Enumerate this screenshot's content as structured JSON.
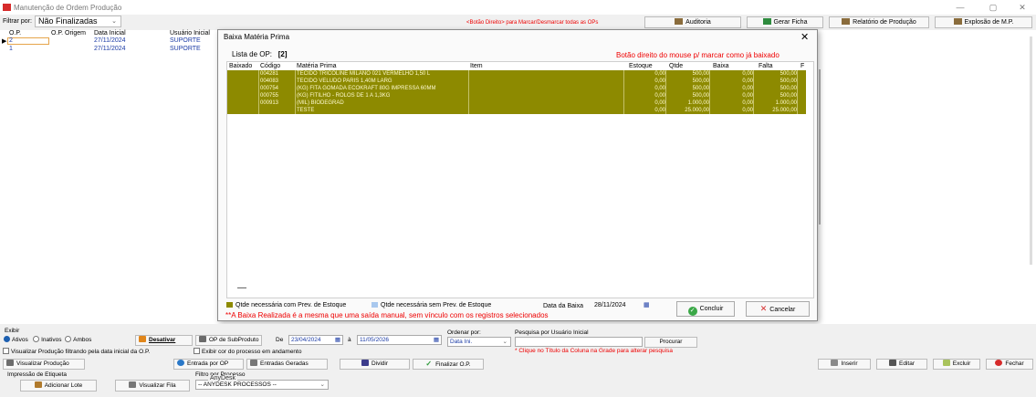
{
  "window": {
    "title": "Manutenção de Ordem Produção",
    "minimize": "—",
    "maximize": "▢",
    "close": "✕"
  },
  "toolbar": {
    "filtrar_label": "Filtrar por:",
    "filtrar_value": "Não Finalizadas",
    "hint": "<Botão Direito> para Marcar/Desmarcar todas as OPs",
    "auditoria": "Auditoria",
    "gerar_ficha": "Gerar Ficha",
    "relatorio": "Relatório de Produção",
    "explosao": "Explosão de M.P."
  },
  "main_grid": {
    "headers": [
      "O.P.",
      "O.P. Origem",
      "Data Inicial",
      "Usuário Inicial"
    ],
    "rows": [
      {
        "op": "2",
        "origem": "",
        "data": "27/11/2024",
        "usuario": "SUPORTE"
      },
      {
        "op": "1",
        "origem": "",
        "data": "27/11/2024",
        "usuario": "SUPORTE"
      }
    ]
  },
  "dialog": {
    "title": "Baixa Matéria Prima",
    "close": "✕",
    "lista_label": "Lista de OP:",
    "lista_value": "[2]",
    "hint": "Botão direito do mouse p/ marcar como já baixado",
    "headers": [
      "Baixado",
      "Código",
      "Matéria Prima",
      "Item",
      "Estoque",
      "Qtde",
      "Baixa",
      "Falta",
      "F"
    ],
    "rows": [
      {
        "codigo": "004281",
        "materia": "TECIDO TRICOLINE MILANO 021 VERMELHO 1,50 L",
        "item": "",
        "estoque": "0,00",
        "qtde": "500,00",
        "baixa": "0,00",
        "falta": "500,00"
      },
      {
        "codigo": "004083",
        "materia": "TECIDO VELUDO PARIS 1,40M LARG",
        "item": "",
        "estoque": "0,00",
        "qtde": "500,00",
        "baixa": "0,00",
        "falta": "500,00"
      },
      {
        "codigo": "000754",
        "materia": "(KG) FITA GOMADA ECOKRAFT 80G IMPRESSA 60MM",
        "item": "",
        "estoque": "0,00",
        "qtde": "500,00",
        "baixa": "0,00",
        "falta": "500,00"
      },
      {
        "codigo": "000755",
        "materia": "(KG) FITILHO - ROLOS DE 1 A 1,3KG",
        "item": "",
        "estoque": "0,00",
        "qtde": "500,00",
        "baixa": "0,00",
        "falta": "500,00"
      },
      {
        "codigo": "000913",
        "materia": "(MIL) BIODEGRAD",
        "item": "",
        "estoque": "0,00",
        "qtde": "1.000,00",
        "baixa": "0,00",
        "falta": "1.000,00"
      },
      {
        "codigo": "",
        "materia": "TESTE",
        "item": "",
        "estoque": "0,00",
        "qtde": "25.000,00",
        "baixa": "0,00",
        "falta": "25.000,00"
      }
    ],
    "legend_with": "Qtde necessária com Prev. de Estoque",
    "legend_without": "Qtde necessária sem Prev. de Estoque",
    "data_baixa_label": "Data da Baixa",
    "data_baixa_value": "28/11/2024",
    "concluir": "Concluir",
    "cancelar": "Cancelar",
    "warning": "**A Baixa Realizada é a mesma que uma saída manual, sem vínculo com os registros selecionados",
    "row_color": "#8d8a00",
    "legend_color_with": "#8d8a00",
    "legend_color_without": "#a9c8ee"
  },
  "bottom": {
    "exibir_label": "Exibir",
    "ativos": "Ativos",
    "inativos": "Inativos",
    "ambos": "Ambos",
    "desativar": "Desativar",
    "op_subproduto": "OP de SubProduto",
    "de_label": "De",
    "de_value": "23/04/2024",
    "a_label": "à",
    "a_value": "11/05/2026",
    "ordenar_label": "Ordenar por:",
    "ordenar_value": "Data Ini.",
    "pesquisa_label": "Pesquisa por Usuário Inicial",
    "procurar": "Procurar",
    "pesquisa_hint": "* Clique no Título da Coluna na Grade para alterar pesquisa",
    "visualizar_filtrando": "Visualizar Produção filtrando pela data inicial da O.P.",
    "exibir_cor": "Exibir cor do processo em andamento",
    "visualizar_producao": "Visualizar Produção",
    "entrada_por_op": "Entrada por OP",
    "entradas_geradas": "Entradas Geradas",
    "dividir": "Dividir",
    "finalizar_op": "Finalizar O.P.",
    "inserir": "Inserir",
    "editar": "Editar",
    "excluir": "Excluir",
    "fechar": "Fechar",
    "impressao_label": "Impressão de Etiqueta",
    "adicionar_lote": "Adicionar Lote",
    "visualizar_fila": "Visualizar Fila",
    "filtro_label": "Filtro por Processo",
    "filtro_value": "-- ANYDESK PROCESSOS --",
    "anydesk": "AnyDesk"
  }
}
